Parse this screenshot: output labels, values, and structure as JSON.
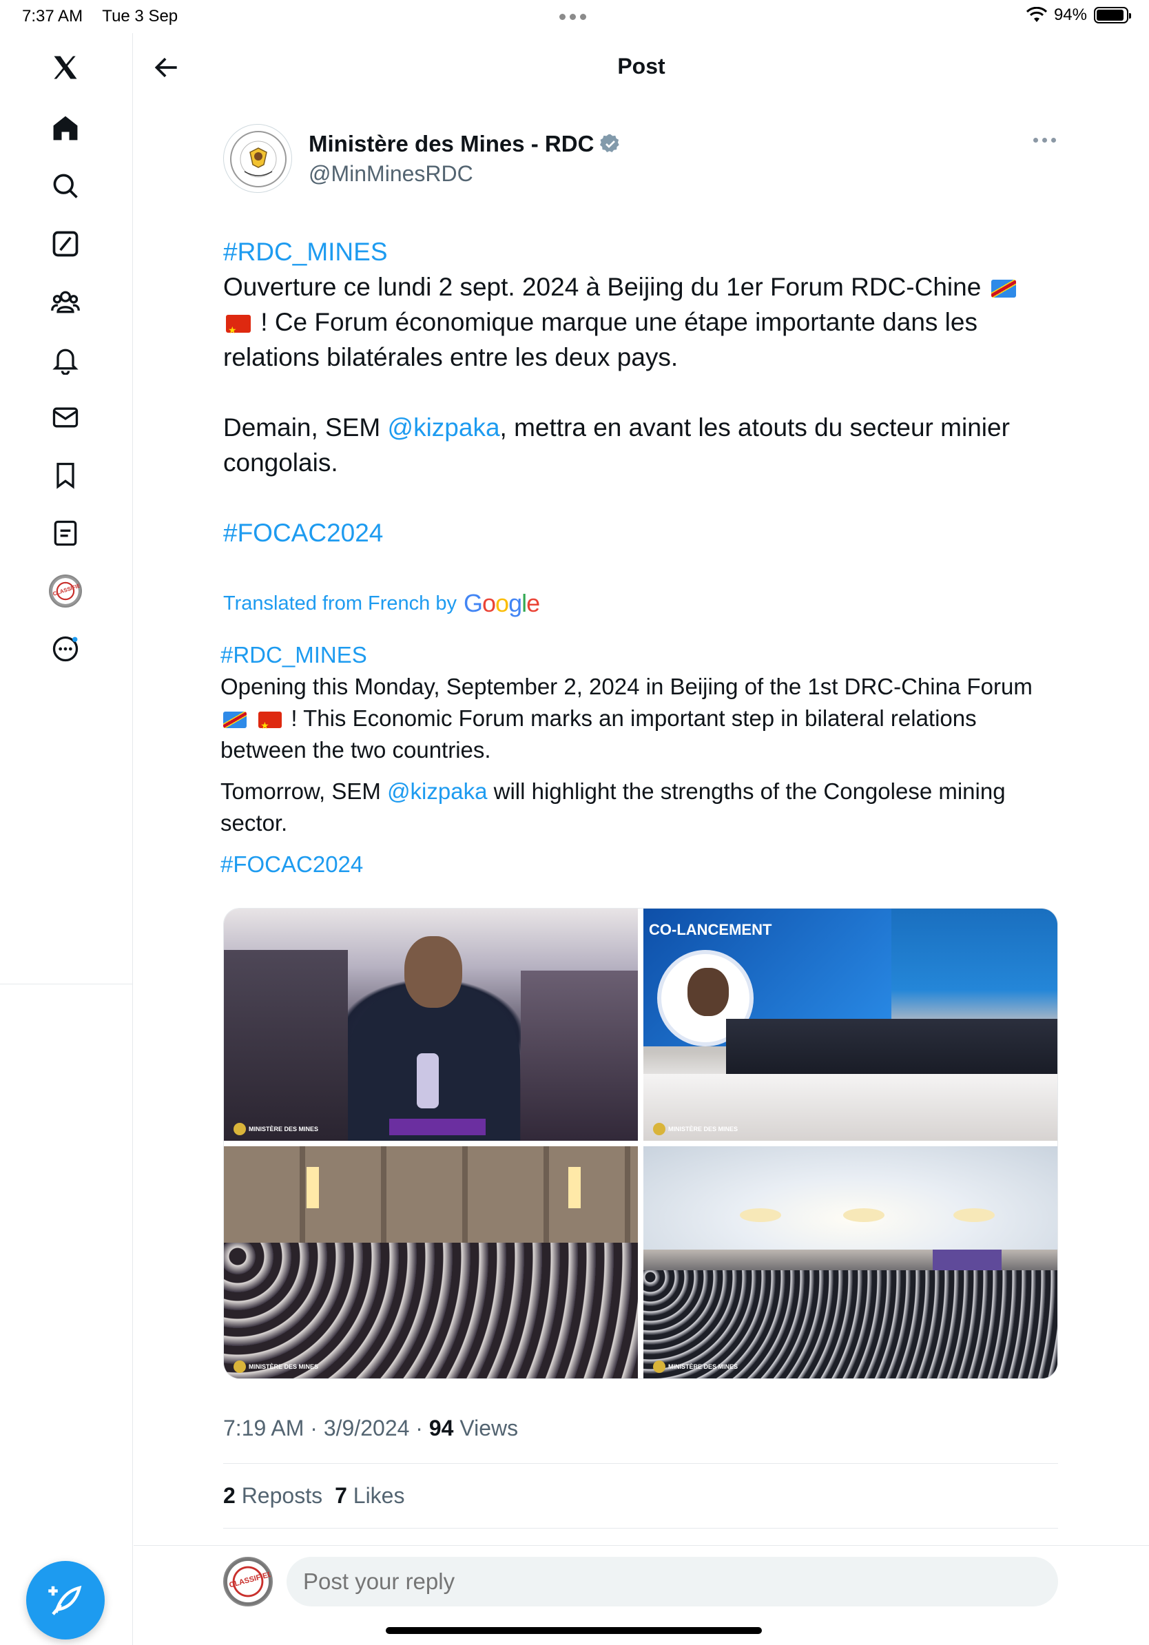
{
  "status_bar": {
    "time": "7:37 AM",
    "date": "Tue 3 Sep",
    "battery": "94%"
  },
  "header": {
    "title": "Post"
  },
  "sidebar": {
    "items": [
      {
        "name": "x-logo"
      },
      {
        "name": "home"
      },
      {
        "name": "search"
      },
      {
        "name": "grok"
      },
      {
        "name": "communities"
      },
      {
        "name": "notifications"
      },
      {
        "name": "messages"
      },
      {
        "name": "bookmarks"
      },
      {
        "name": "lists"
      },
      {
        "name": "profile"
      },
      {
        "name": "more"
      }
    ],
    "profile_badge": "CLASSIFIED"
  },
  "post": {
    "author": {
      "name": "Ministère des Mines - RDC",
      "handle": "@MinMinesRDC",
      "verified": true
    },
    "original": {
      "hashtag1": "#RDC_MINES",
      "line1a": "Ouverture ce lundi 2 sept. 2024 à Beijing du 1er Forum RDC-Chine",
      "line1b": "! Ce Forum économique marque une étape importante dans les relations bilatérales entre les deux pays.",
      "line2a": "Demain, SEM ",
      "mention": "@kizpaka",
      "line2b": ", mettra en avant les atouts du secteur minier congolais.",
      "hashtag2": "#FOCAC2024"
    },
    "translated_label": "Translated from French by",
    "google": "Google",
    "translation": {
      "hashtag1": "#RDC_MINES",
      "line1a": "Opening this Monday, September 2, 2024 in Beijing of the 1st DRC-China Forum",
      "line1b": "! This Economic Forum marks an important step in bilateral relations between the two countries.",
      "line2a": "Tomorrow, SEM ",
      "mention": "@kizpaka",
      "line2b": " will highlight the strengths of the Congolese mining sector.",
      "hashtag2": "#FOCAC2024"
    },
    "images": {
      "screen_text": "CO-LANCEMENT",
      "watermark": "MINISTÈRE DES MINES"
    },
    "timestamp": "7:19 AM · 3/9/2024 · ",
    "views_count": "94",
    "views_label": " Views",
    "reposts_count": "2",
    "reposts_label": " Reposts",
    "likes_count": "7",
    "likes_label": " Likes"
  },
  "reply": {
    "placeholder": "Post your reply",
    "avatar_badge": "CLASSIFIED"
  },
  "colors": {
    "accent": "#1d9bf0",
    "text": "#0f1419",
    "secondary": "#536471"
  }
}
